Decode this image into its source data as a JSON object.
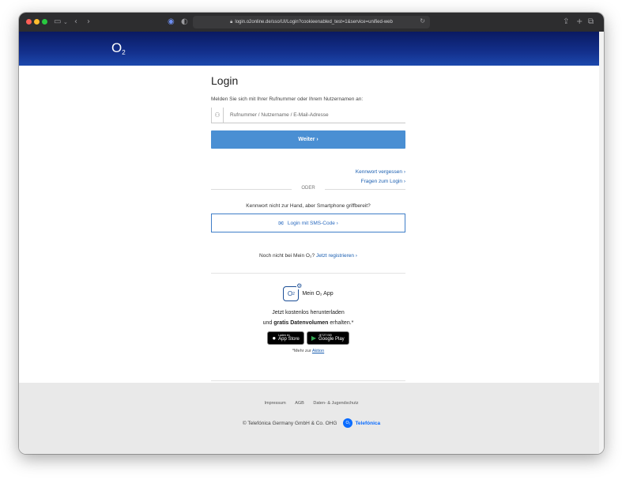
{
  "browser": {
    "url": "login.o2online.de/sso/UI/Login?cookieenabled_test=1&service=unified-web"
  },
  "header": {
    "logo": "O",
    "logo_sub": "2"
  },
  "login": {
    "title": "Login",
    "intro": "Melden Sie sich mit Ihrer Rufnummer oder Ihrem Nutzernamen an:",
    "input_placeholder": "Rufnummer / Nutzername / E-Mail-Adresse",
    "next_button": "Weiter ›",
    "forgot_password": "Kennwort vergessen ›",
    "questions": "Fragen zum Login ›",
    "or_label": "ODER",
    "sms_question": "Kennwort nicht zur Hand, aber Smartphone griffbereit?",
    "sms_button": "Login mit SMS-Code ›",
    "register_prefix": "Noch nicht bei Mein O₂?",
    "register_link": "Jetzt registrieren ›"
  },
  "app_promo": {
    "title": "Mein O₂ App",
    "line1": "Jetzt kostenlos herunterladen",
    "line2_prefix": "und ",
    "line2_bold": "gratis Datenvolumen",
    "line2_suffix": " erhalten.*",
    "appstore_small": "Laden im",
    "appstore_big": "App Store",
    "googleplay_small": "JETZT BEI",
    "googleplay_big": "Google Play",
    "footnote_prefix": "*Mehr zur ",
    "footnote_link": "Aktion"
  },
  "footer": {
    "links": [
      "Impressum",
      "AGB",
      "Daten- & Jugendschutz"
    ],
    "copyright": "© Telefónica Germany GmbH & Co. OHG",
    "brand_logo": "O₂",
    "brand": "Telefónica"
  },
  "colors": {
    "header_top": "#0a1a62",
    "primary_button": "#4a8fd3",
    "link": "#1b5fb1"
  }
}
